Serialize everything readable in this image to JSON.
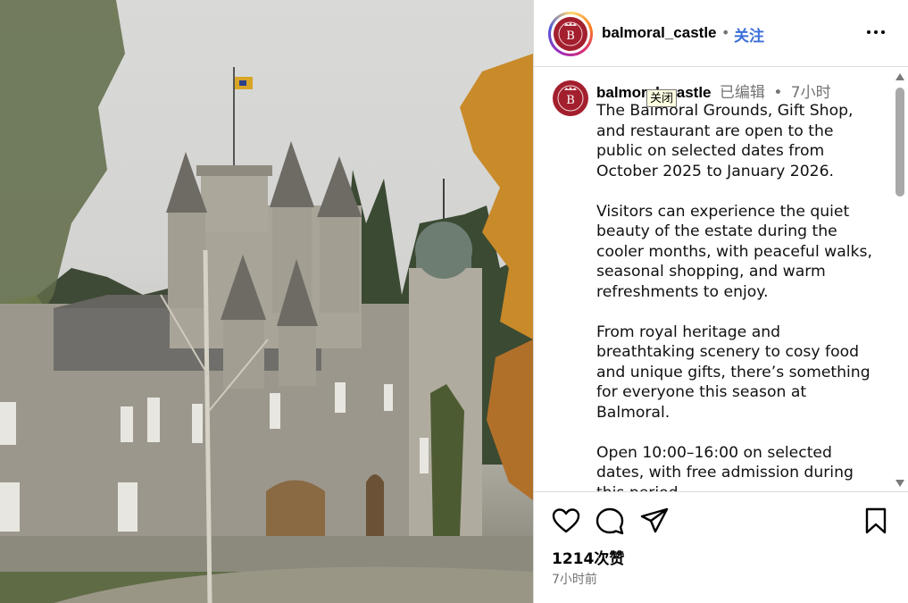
{
  "post": {
    "image_alt": "Balmoral Castle in autumn"
  },
  "header": {
    "username": "balmoral_castle",
    "separator": "•",
    "follow_label": "关注",
    "more_icon": "more-horizontal-icon",
    "avatar_letter": "B"
  },
  "caption": {
    "username": "balmoral_castle",
    "edited_label": "已编辑",
    "separator": "•",
    "time": "7小时",
    "avatar_letter": "B",
    "text": "The Balmoral Grounds, Gift Shop, and restaurant are open to the public on selected dates from October 2025 to January 2026.\n\nVisitors can experience the quiet beauty of the estate during the cooler months, with peaceful walks, seasonal shopping, and warm refreshments to enjoy.\n\nFrom royal heritage and breathtaking scenery to cosy food and unique gifts, there’s something for everyone this season at Balmoral.\n\nOpen 10:00–16:00 on selected dates, with free admission during this period."
  },
  "tooltip": {
    "text": "关闭"
  },
  "actions": {
    "like_icon": "heart-icon",
    "comment_icon": "comment-icon",
    "share_icon": "share-icon",
    "save_icon": "bookmark-icon",
    "likes_text": "1214次赞",
    "posted_time": "7小时前"
  },
  "colors": {
    "brand_red": "#a31f2e",
    "follow_blue": "#3b6fd8",
    "muted_text": "#737373",
    "divider": "#dbdbdb"
  }
}
